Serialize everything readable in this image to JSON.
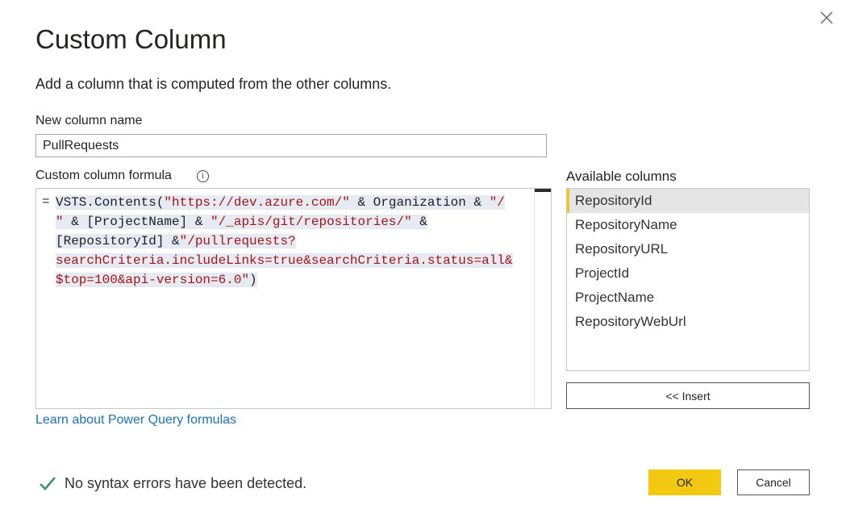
{
  "dialog": {
    "title": "Custom Column",
    "subtitle": "Add a column that is computed from the other columns."
  },
  "name_field": {
    "label": "New column name",
    "value": "PullRequests"
  },
  "formula": {
    "label": "Custom column formula",
    "info_icon": "info-icon",
    "prefix": "=",
    "lines": [
      [
        {
          "t": "fn",
          "v": "VSTS.Contents("
        },
        {
          "t": "str",
          "v": "\"https://dev.azure.com/\""
        },
        {
          "t": "op",
          "v": " & Organization & "
        },
        {
          "t": "str",
          "v": "\"/"
        }
      ],
      [
        {
          "t": "str",
          "v": "\""
        },
        {
          "t": "op",
          "v": " & [ProjectName] & "
        },
        {
          "t": "str",
          "v": "\"/_apis/git/repositories/\""
        },
        {
          "t": "op",
          "v": " &"
        }
      ],
      [
        {
          "t": "op",
          "v": "[RepositoryId] &"
        },
        {
          "t": "str",
          "v": "\"/pullrequests?"
        }
      ],
      [
        {
          "t": "str",
          "v": "searchCriteria.includeLinks=true&searchCriteria.status=all&"
        }
      ],
      [
        {
          "t": "str",
          "v": "$top=100&api-version=6.0\""
        },
        {
          "t": "op",
          "v": ")"
        }
      ]
    ]
  },
  "available_columns": {
    "label": "Available columns",
    "selected": "RepositoryId",
    "items": [
      "RepositoryId",
      "RepositoryName",
      "RepositoryURL",
      "ProjectId",
      "ProjectName",
      "RepositoryWebUrl"
    ],
    "insert_label": "<< Insert"
  },
  "learn_link": "Learn about Power Query formulas",
  "status": {
    "icon": "checkmark-icon",
    "text": "No syntax errors have been detected."
  },
  "buttons": {
    "ok": "OK",
    "cancel": "Cancel"
  },
  "colors": {
    "accent": "#f2c811",
    "link": "#1b72b8",
    "string": "#a31515",
    "check": "#3a8f6f"
  }
}
